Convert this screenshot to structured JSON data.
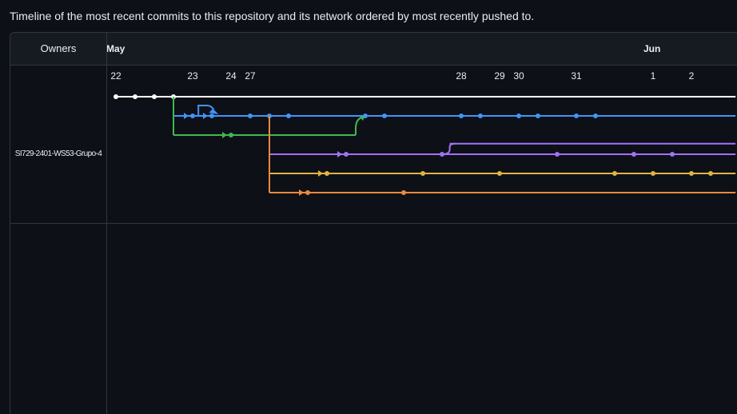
{
  "description": "Timeline of the most recent commits to this repository and its network ordered by most recently pushed to.",
  "header": {
    "owners_label": "Owners",
    "months": [
      {
        "label": "May",
        "day_index": 0
      },
      {
        "label": "Jun",
        "day_index": 28.5
      }
    ]
  },
  "owner": {
    "name": "SI729-2401-WS53-Grupo-4"
  },
  "days": [
    {
      "label": "22",
      "slot": 0
    },
    {
      "label": "23",
      "slot": 4
    },
    {
      "label": "24",
      "slot": 6
    },
    {
      "label": "27",
      "slot": 7
    },
    {
      "label": "28",
      "slot": 18
    },
    {
      "label": "29",
      "slot": 20
    },
    {
      "label": "30",
      "slot": 21
    },
    {
      "label": "31",
      "slot": 24
    },
    {
      "label": "1",
      "slot": 28
    },
    {
      "label": "2",
      "slot": 30
    }
  ],
  "branches": [
    {
      "name": "main",
      "color": "#ffffff",
      "row": 0,
      "from": 0,
      "to": 32.3,
      "commits": [
        0,
        1,
        2,
        3
      ]
    },
    {
      "name": "branch-blue",
      "color": "#4493f8",
      "row": 1,
      "from": 3,
      "to": 32.3,
      "parent_row": 0,
      "commits": [
        4,
        5,
        7,
        8,
        9,
        13,
        14,
        18,
        19,
        21,
        22,
        24,
        25
      ]
    },
    {
      "name": "branch-green",
      "color": "#3fb950",
      "row": 2,
      "from": 3,
      "to": 12.5,
      "parent_row": 0,
      "merge_to_row": 1,
      "merge_at": 13,
      "commits": [
        6
      ]
    },
    {
      "name": "branch-purple",
      "color": "#a371f7",
      "row": 3,
      "from": 8,
      "to": 32.3,
      "parent_row": 1,
      "commits": [
        12,
        17,
        23,
        27,
        29
      ]
    },
    {
      "name": "branch-purple-2",
      "color": "#a371f7",
      "row": 2.45,
      "from": 17.4,
      "to": 32.3,
      "commits": []
    },
    {
      "name": "branch-yellow",
      "color": "#e3b341",
      "row": 4,
      "from": 8,
      "to": 32.3,
      "parent_row": 1,
      "commits": [
        11,
        16,
        20,
        26,
        28,
        30,
        31
      ]
    },
    {
      "name": "branch-orange",
      "color": "#f0883e",
      "row": 5,
      "from": 8,
      "to": 32.3,
      "parent_row": 1,
      "commits": [
        10,
        15
      ]
    }
  ]
}
